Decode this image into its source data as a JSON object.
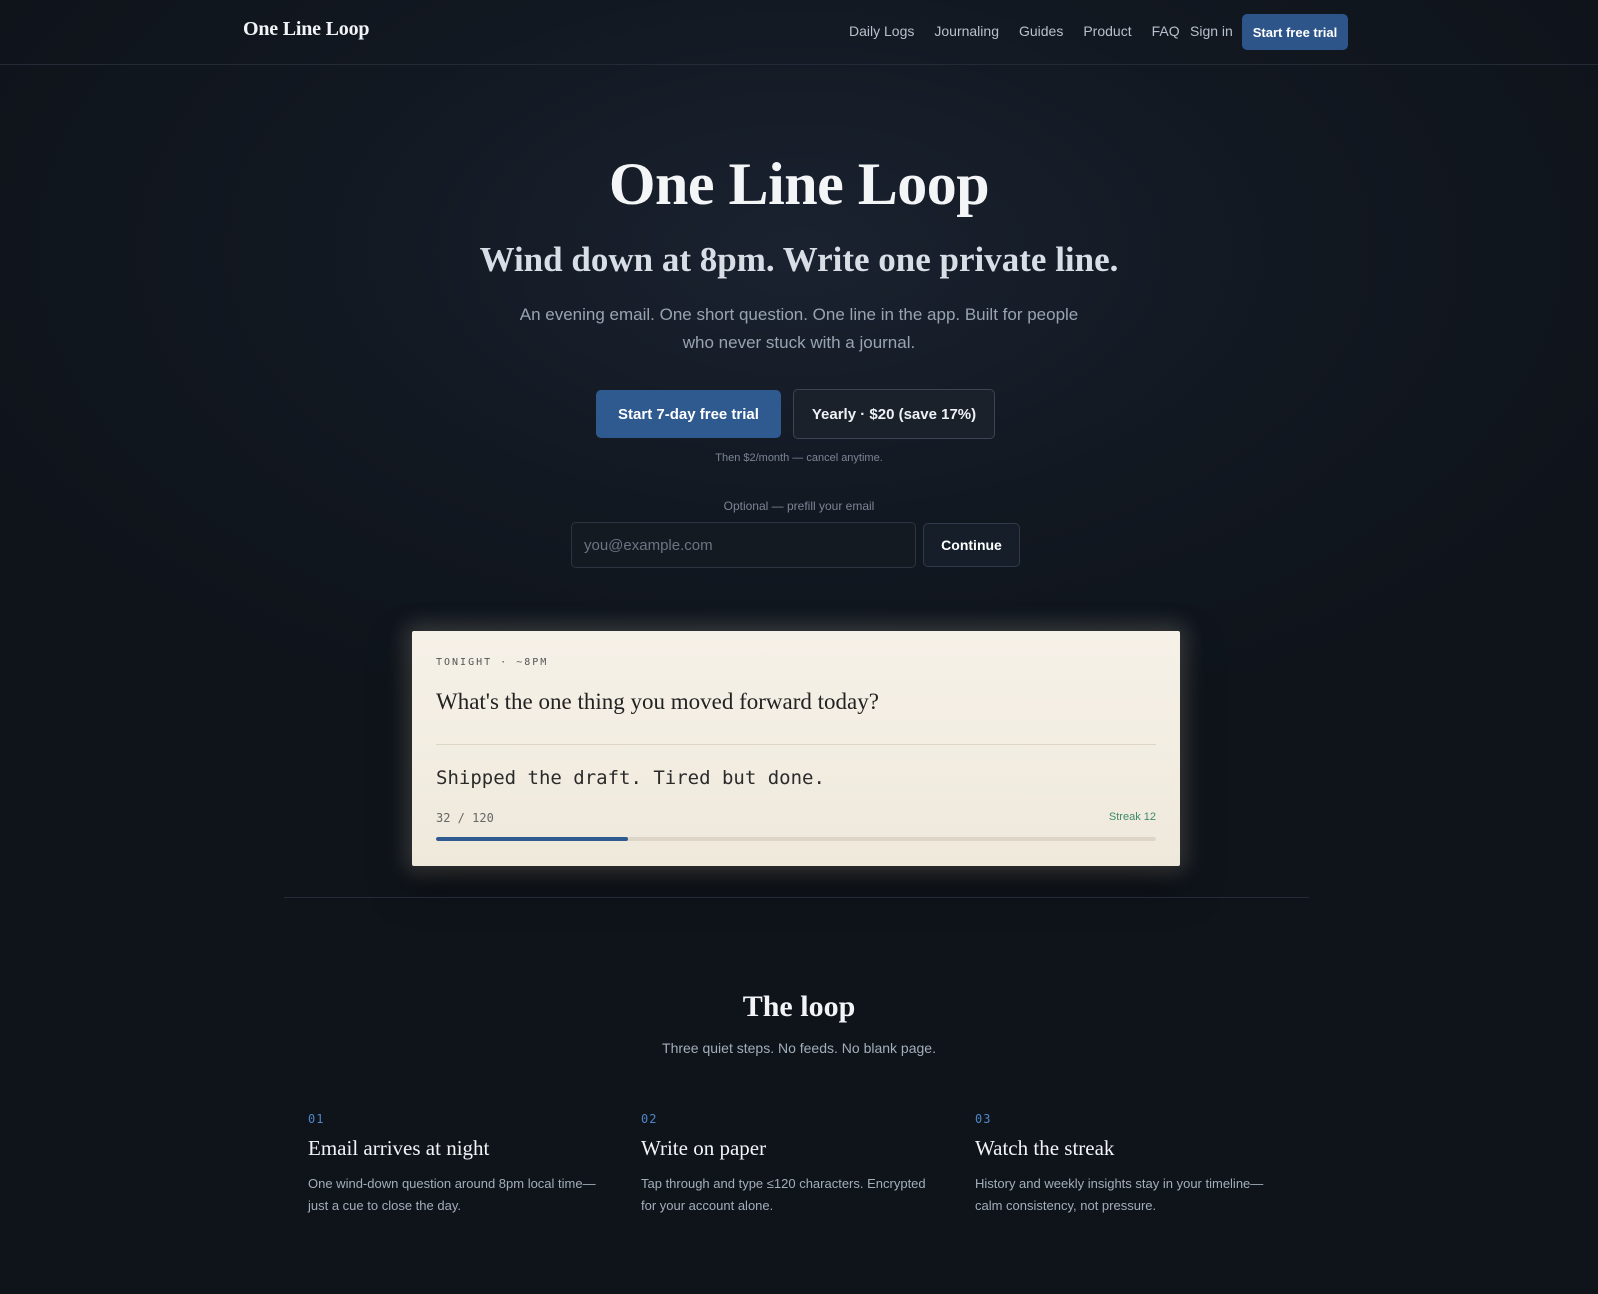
{
  "nav": {
    "brand": "One Line Loop",
    "links": [
      "Daily Logs",
      "Journaling",
      "Guides",
      "Product",
      "FAQ"
    ],
    "sign_in": "Sign in",
    "cta": "Start free trial"
  },
  "hero": {
    "title": "One Line Loop",
    "subtitle": "Wind down at 8pm. Write one private line.",
    "description": "An evening email. One short question. One line in the app. Built for people who never stuck with a journal.",
    "primary_button": "Start 7-day free trial",
    "secondary_button": "Yearly · $20 (save 17%)",
    "price_note": "Then $2/month — cancel anytime.",
    "prefill_label": "Optional — prefill your email",
    "email_placeholder": "you@example.com",
    "email_value": "",
    "continue_button": "Continue"
  },
  "card": {
    "kicker": "TONIGHT · ~8PM",
    "question": "What's the one thing you moved forward today?",
    "answer": "Shipped the draft. Tired but done.",
    "char_count": "32 / 120",
    "streak": "Streak 12",
    "progress_fraction": 0.267
  },
  "loop": {
    "title": "The loop",
    "subtitle": "Three quiet steps. No feeds. No blank page.",
    "steps": [
      {
        "num": "01",
        "title": "Email arrives at night",
        "desc": "One wind-down question around 8pm local time—just a cue to close the day."
      },
      {
        "num": "02",
        "title": "Write on paper",
        "desc": "Tap through and type ≤120 characters. Encrypted for your account alone."
      },
      {
        "num": "03",
        "title": "Watch the streak",
        "desc": "History and weekly insights stay in your timeline—calm consistency, not pressure."
      }
    ]
  },
  "colors": {
    "accent": "#2e5a8f",
    "background": "#121821",
    "card": "#f3eee4",
    "streak": "#3e8a6b"
  }
}
